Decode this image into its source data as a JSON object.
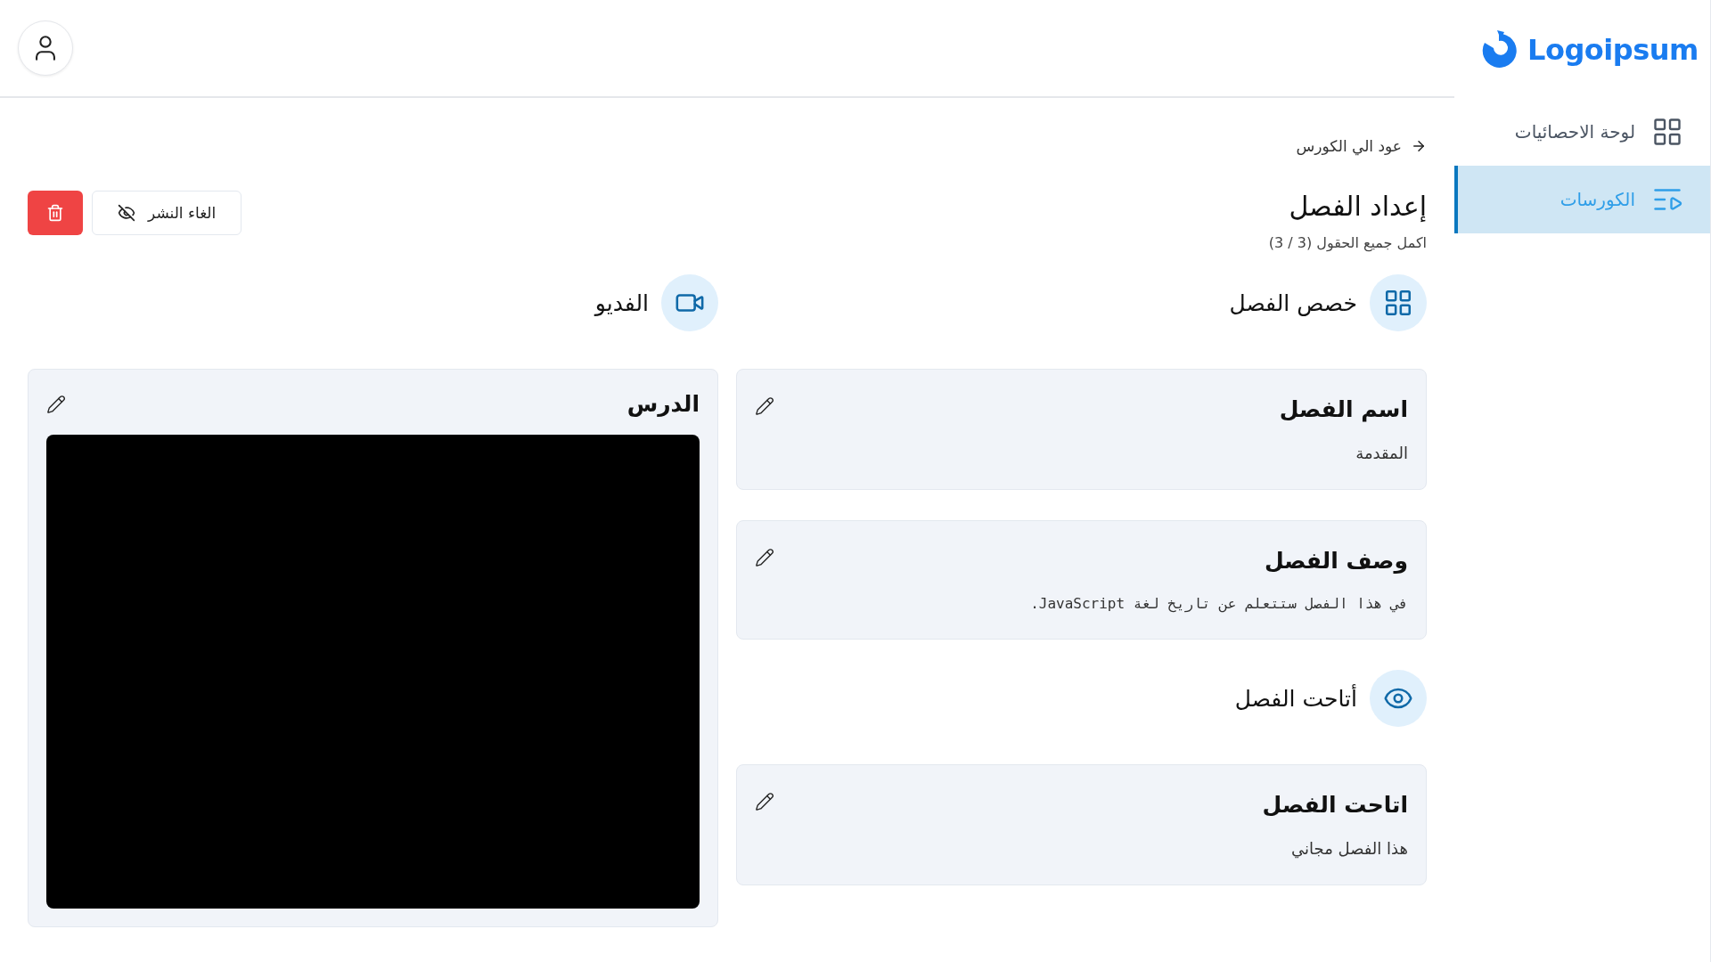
{
  "brand": {
    "name": "Logoipsum"
  },
  "sidebar": {
    "items": [
      {
        "label": "لوحة الاحصائيات",
        "selected": false
      },
      {
        "label": "الكورسات",
        "selected": true
      }
    ]
  },
  "back_link": "عود الي الكورس",
  "page_title": "إعداد الفصل",
  "progress": "اكمل جميع الحقول (3 / 3)",
  "actions": {
    "unpublish": "الغاء النشر"
  },
  "customize_section": {
    "heading": "خصص الفصل",
    "cards": [
      {
        "title": "اسم الفصل",
        "value": "المقدمة",
        "kind": "text"
      },
      {
        "title": "وصف الفصل",
        "value": "في هذا الفصل ستتعلم عن تاريخ لغة JavaScript.",
        "kind": "code"
      }
    ]
  },
  "access_section": {
    "heading": "أتاحت الفصل",
    "cards": [
      {
        "title": "اتاحت الفصل",
        "value": "هذا الفصل مجاني",
        "kind": "text"
      }
    ]
  },
  "video_section": {
    "heading": "الفديو",
    "card": {
      "title": "الدرس"
    }
  }
}
